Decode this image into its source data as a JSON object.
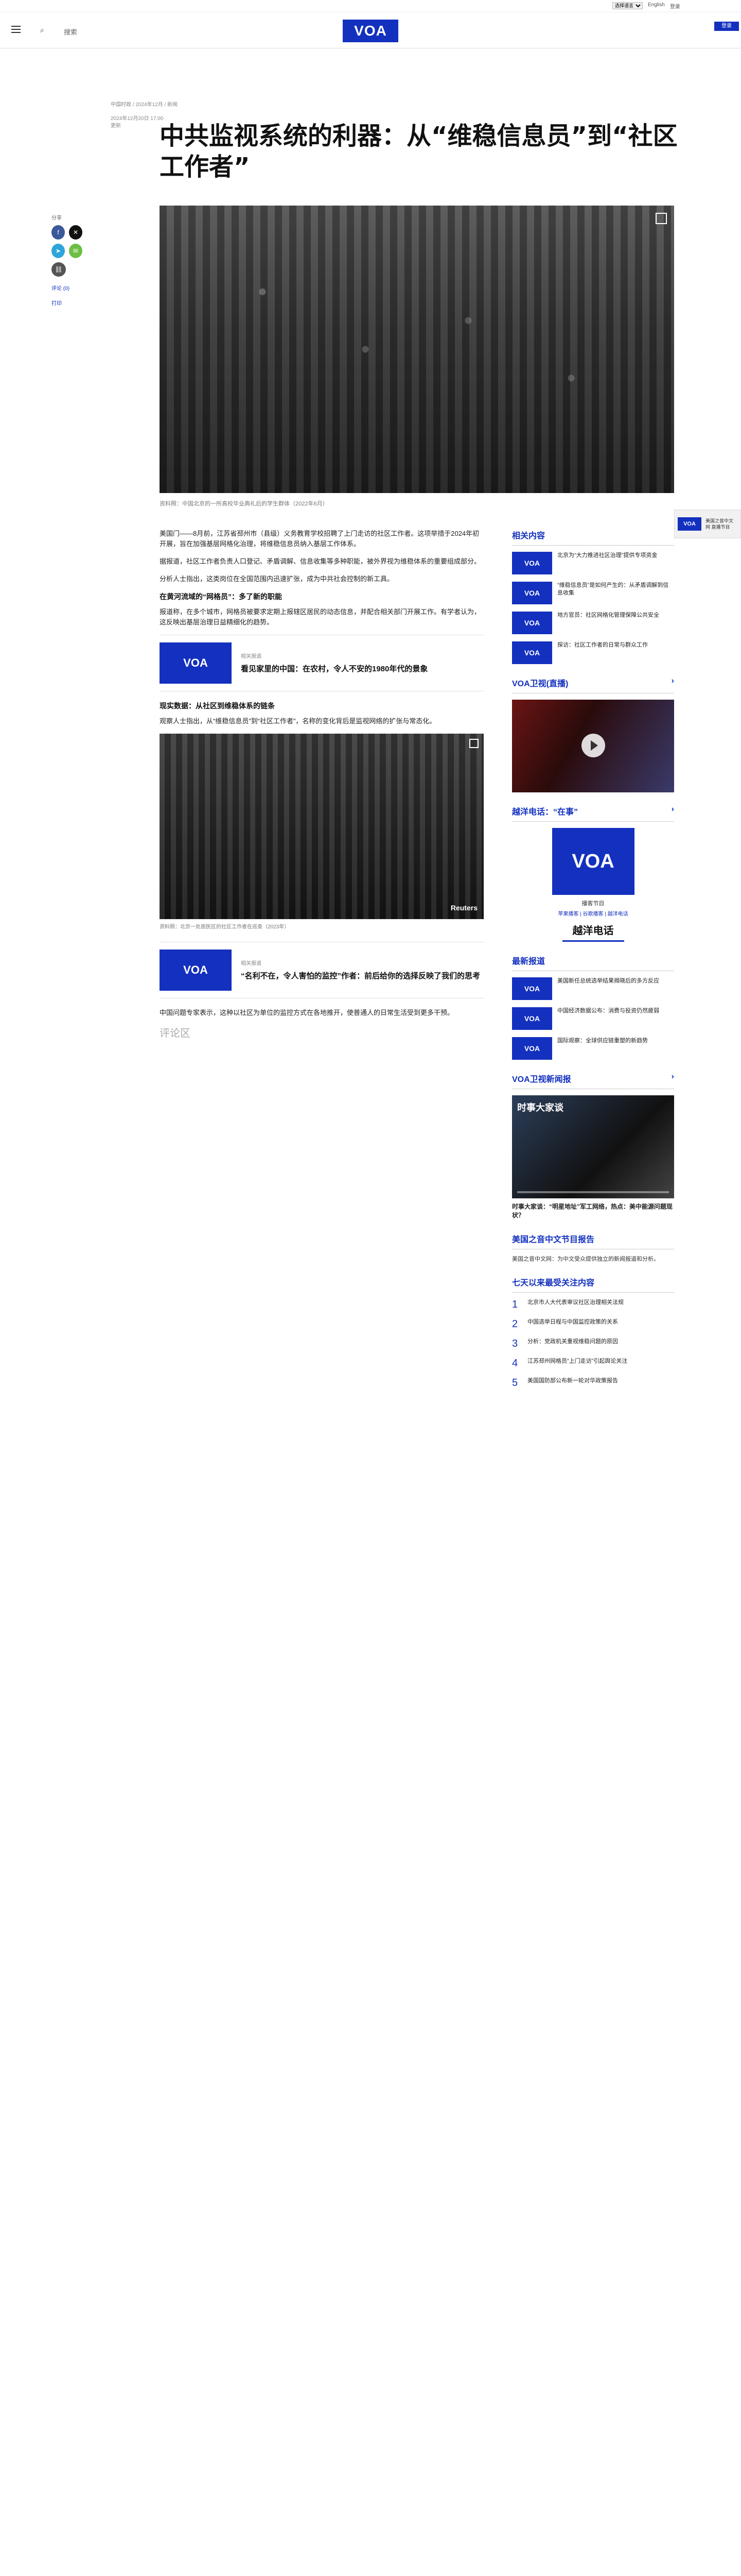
{
  "util": {
    "lang_select": "选择语言",
    "links": [
      "English",
      "登录"
    ]
  },
  "header": {
    "search_label": "搜索",
    "logo": "VOA",
    "login": "登录"
  },
  "breadcrumb": "中国时政 / 2024年12月 / 新闻",
  "meta_top": [
    "2024年12月20日 17:00",
    "更新"
  ],
  "title": "中共监视系统的利器：从“维稳信息员”到“社区工作者”",
  "share": {
    "label": "分享",
    "more_link": "评论 (0)",
    "print": "打印"
  },
  "caption": "资料照：中国北京的一所高校毕业典礼后的学生群体（2022年6月）",
  "body": [
    "美国门——8月前，江苏省邳州市（县级）义务教育学校招聘了上门走访的社区工作者。这项举措于2024年初开展，旨在加强基层网格化治理，将维稳信息员纳入基层工作体系。",
    "据报道，社区工作者负责人口登记、矛盾调解、信息收集等多种职能，被外界视为维稳体系的重要组成部分。",
    "分析人士指出，这类岗位在全国范围内迅速扩张，成为中共社会控制的新工具。"
  ],
  "sections": [
    {
      "heading": "在黄河流域的“网格员”：多了新的职能",
      "text": "报道称，在多个城市，网格员被要求定期上报辖区居民的动态信息，并配合相关部门开展工作。有学者认为，这反映出基层治理日益精细化的趋势。"
    },
    {
      "heading": "现实数据：从社区到维稳体系的链条",
      "text": "观察人士指出，从“维稳信息员”到“社区工作者”，名称的变化背后是监视网络的扩张与常态化。"
    }
  ],
  "related1": {
    "label": "相关报道",
    "title": "看见家里的中国：在农村，令人不安的1980年代的景象"
  },
  "mid_image": {
    "credit": "Reuters",
    "caption": "资料照：北京一处居民区的社区工作者在巡查（2023年）"
  },
  "related2": {
    "label": "相关报道",
    "title": "“名利不在，令人害怕的监控”作者：前后给你的选择反映了我们的思考"
  },
  "closing": "中国问题专家表示，这种以社区为单位的监控方式在各地推开，使普通人的日常生活受到更多干预。",
  "comments_label": "评论区",
  "sidebar": {
    "h1": "相关内容",
    "related": [
      "北京为“大力推进社区治理”提供专项资金",
      "“维稳信息员”是如何产生的：从矛盾调解到信息收集",
      "地方官员：社区网格化管理保障公共安全",
      "探访：社区工作者的日常与群众工作"
    ],
    "h2": "VOA卫视(直播)",
    "h3": "越洋电话：“在事”",
    "podcast_title": "播客节目",
    "podcast_links": "苹果播客 | 谷歌播客 | 越洋电话",
    "podcast_name": "越洋电话",
    "h4": "最新报道",
    "latest": [
      "美国新任总统选举结果揭晓后的多方反应",
      "中国经济数据公布：消费与投资仍然疲弱",
      "国际观察：全球供应链重塑的新趋势"
    ],
    "h5": "VOA卫视新闻报",
    "video_caption": "时事大家谈",
    "video_title": "时事大家谈：“明星地址”军工网络，热点：美中能源问题现状？",
    "h6": "美国之音中文节目报告",
    "text_item": "美国之音中文网：为中文受众提供独立的新闻报道和分析。",
    "h7": "七天以来最受关注内容",
    "top": [
      "北京市人大代表审议社区治理相关法规",
      "中国选举日程与中国监控政策的关系",
      "分析：党政机关重视维稳问题的原因",
      "江苏邳州网格员“上门走访”引起舆论关注",
      "美国国防部公布新一轮对华政策报告"
    ]
  },
  "floater": {
    "logo": "VOA",
    "text": "美国之音中文网 直播节目"
  }
}
